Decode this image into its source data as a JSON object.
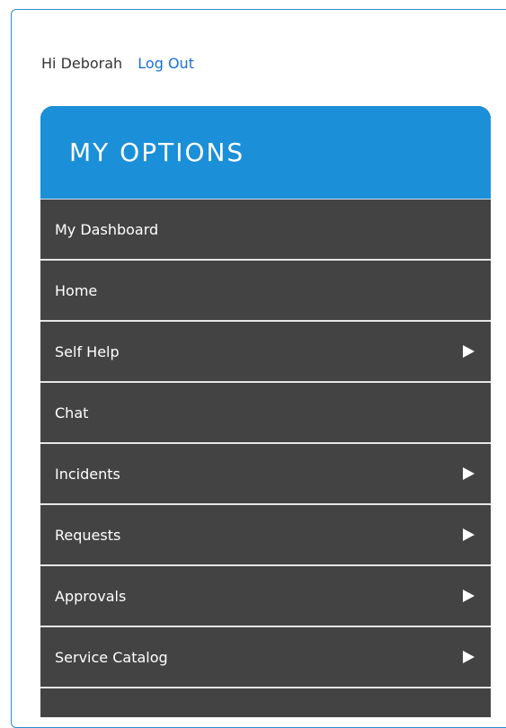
{
  "greeting": {
    "hello_text": "Hi Deborah",
    "logout_label": "Log Out"
  },
  "menu": {
    "title": "MY OPTIONS",
    "items": [
      {
        "label": "My Dashboard",
        "has_submenu": false
      },
      {
        "label": "Home",
        "has_submenu": false
      },
      {
        "label": "Self Help",
        "has_submenu": true
      },
      {
        "label": "Chat",
        "has_submenu": false
      },
      {
        "label": "Incidents",
        "has_submenu": true
      },
      {
        "label": "Requests",
        "has_submenu": true
      },
      {
        "label": "Approvals",
        "has_submenu": true
      },
      {
        "label": "Service Catalog",
        "has_submenu": true
      },
      {
        "label": "",
        "has_submenu": false
      }
    ]
  },
  "colors": {
    "header_blue": "#1b8fd8",
    "menu_dark": "#434343",
    "link_blue": "#1a6fd8",
    "frame_border": "#2a8fd0"
  },
  "icons": {
    "submenu_arrow": "triangle-right-icon"
  }
}
